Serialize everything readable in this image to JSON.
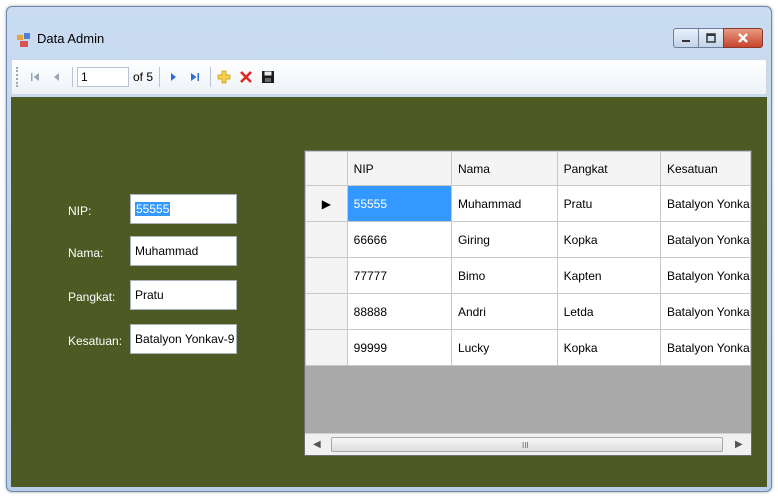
{
  "window": {
    "title": "Data Admin"
  },
  "toolbar": {
    "position_value": "1",
    "of_label": "of 5"
  },
  "form": {
    "nip_label": "NIP:",
    "nip_value": "55555",
    "nama_label": "Nama:",
    "nama_value": "Muhammad",
    "pangkat_label": "Pangkat:",
    "pangkat_value": "Pratu",
    "kesatuan_label": "Kesatuan:",
    "kesatuan_value": "Batalyon Yonkav-9"
  },
  "grid": {
    "headers": [
      "NIP",
      "Nama",
      "Pangkat",
      "Kesatuan"
    ],
    "rows": [
      [
        "55555",
        "Muhammad",
        "Pratu",
        "Batalyon Yonka"
      ],
      [
        "66666",
        "Giring",
        "Kopka",
        "Batalyon Yonka"
      ],
      [
        "77777",
        "Bimo",
        "Kapten",
        "Batalyon Yonka"
      ],
      [
        "88888",
        "Andri",
        "Letda",
        "Batalyon Yonka"
      ],
      [
        "99999",
        "Lucky",
        "Kopka",
        "Batalyon Yonka"
      ]
    ],
    "current_row_marker": "▶",
    "scroll_grip": "III"
  },
  "colors": {
    "client_background": "#4d5a23",
    "selection": "#3399ff",
    "close_button": "#c8452c"
  },
  "icons": [
    "app-icon",
    "first-record-icon",
    "previous-record-icon",
    "next-record-icon",
    "last-record-icon",
    "add-icon",
    "delete-icon",
    "save-icon",
    "minimize-icon",
    "maximize-icon",
    "close-icon"
  ]
}
